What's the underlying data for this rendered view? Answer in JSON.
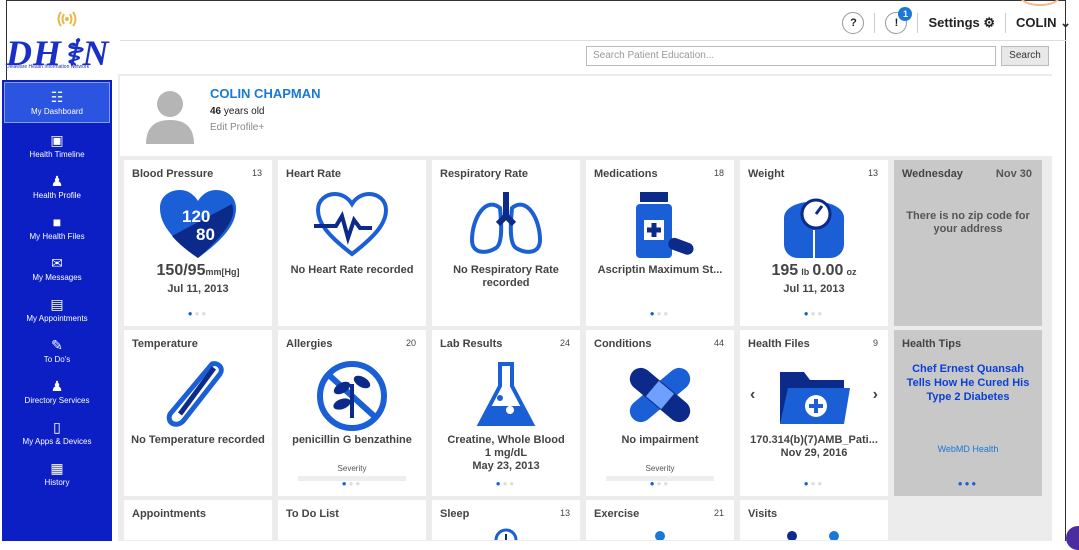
{
  "brand": {
    "logo_text": "DH⚕N",
    "tagline": "Delaware Health Information Network"
  },
  "topbar": {
    "help_label": "?",
    "alert_label": "!",
    "alert_count": "1",
    "settings_label": "Settings ⚙",
    "user_label": "COLIN ⌄"
  },
  "search": {
    "placeholder": "Search Patient Education...",
    "button_label": "Search"
  },
  "sidebar": {
    "items": [
      {
        "icon": "grid-icon",
        "glyph": "☷",
        "label": "My Dashboard",
        "active": true
      },
      {
        "icon": "timeline-icon",
        "glyph": "▣",
        "label": "Health Timeline"
      },
      {
        "icon": "person-icon",
        "glyph": "♟",
        "label": "Health Profile"
      },
      {
        "icon": "file-icon",
        "glyph": "■",
        "label": "My Health Files"
      },
      {
        "icon": "envelope-icon",
        "glyph": "✉",
        "label": "My Messages"
      },
      {
        "icon": "appointment-icon",
        "glyph": "▤",
        "label": "My Appointments"
      },
      {
        "icon": "edit-icon",
        "glyph": "✎",
        "label": "To Do's"
      },
      {
        "icon": "directory-icon",
        "glyph": "♟",
        "label": "Directory Services"
      },
      {
        "icon": "device-icon",
        "glyph": "▯",
        "label": "My Apps & Devices"
      },
      {
        "icon": "calendar-icon",
        "glyph": "▦",
        "label": "History"
      }
    ]
  },
  "profile": {
    "name": "COLIN CHAPMAN",
    "age_number": "46",
    "age_suffix": " years old",
    "edit_label": "Edit Profile+"
  },
  "tiles": {
    "bp": {
      "title": "Blood Pressure",
      "count": "13",
      "sys": "120",
      "dia": "80",
      "value": "150/95",
      "unit": "mm[Hg]",
      "date": "Jul 11, 2013"
    },
    "hr": {
      "title": "Heart Rate",
      "value": "No Heart Rate recorded"
    },
    "rr": {
      "title": "Respiratory Rate",
      "value": "No Respiratory Rate recorded"
    },
    "med": {
      "title": "Medications",
      "count": "18",
      "value": "Ascriptin Maximum St..."
    },
    "wt": {
      "title": "Weight",
      "count": "13",
      "lb": "195",
      "lb_unit": "lb",
      "oz": "0.00",
      "oz_unit": "oz",
      "date": "Jul 11, 2013"
    },
    "day": {
      "title": "Wednesday",
      "date": "Nov 30",
      "message": "There is no zip code for your address"
    },
    "temp": {
      "title": "Temperature",
      "value": "No Temperature recorded"
    },
    "allergy": {
      "title": "Allergies",
      "count": "20",
      "value": "penicillin G benzathine",
      "severity": "Severity"
    },
    "lab": {
      "title": "Lab Results",
      "count": "24",
      "value": "Creatine, Whole Blood",
      "sub1": "1 mg/dL",
      "date": "May 23, 2013"
    },
    "cond": {
      "title": "Conditions",
      "count": "44",
      "value": "No impairment",
      "severity": "Severity"
    },
    "files": {
      "title": "Health Files",
      "count": "9",
      "value": "170.314(b)(7)AMB_Pati...",
      "date": "Nov 29, 2016"
    },
    "tips": {
      "title": "Health Tips",
      "headline": "Chef Ernest Quansah Tells How He Cured His Type 2 Diabetes",
      "source": "WebMD Health"
    },
    "appt": {
      "title": "Appointments"
    },
    "todo": {
      "title": "To Do List"
    },
    "sleep": {
      "title": "Sleep",
      "count": "13"
    },
    "exercise": {
      "title": "Exercise",
      "count": "21"
    },
    "visits": {
      "title": "Visits"
    }
  },
  "colors": {
    "brand_blue": "#0b1fc4",
    "icon_blue": "#1a5fd6",
    "link_blue": "#1a78d6"
  }
}
